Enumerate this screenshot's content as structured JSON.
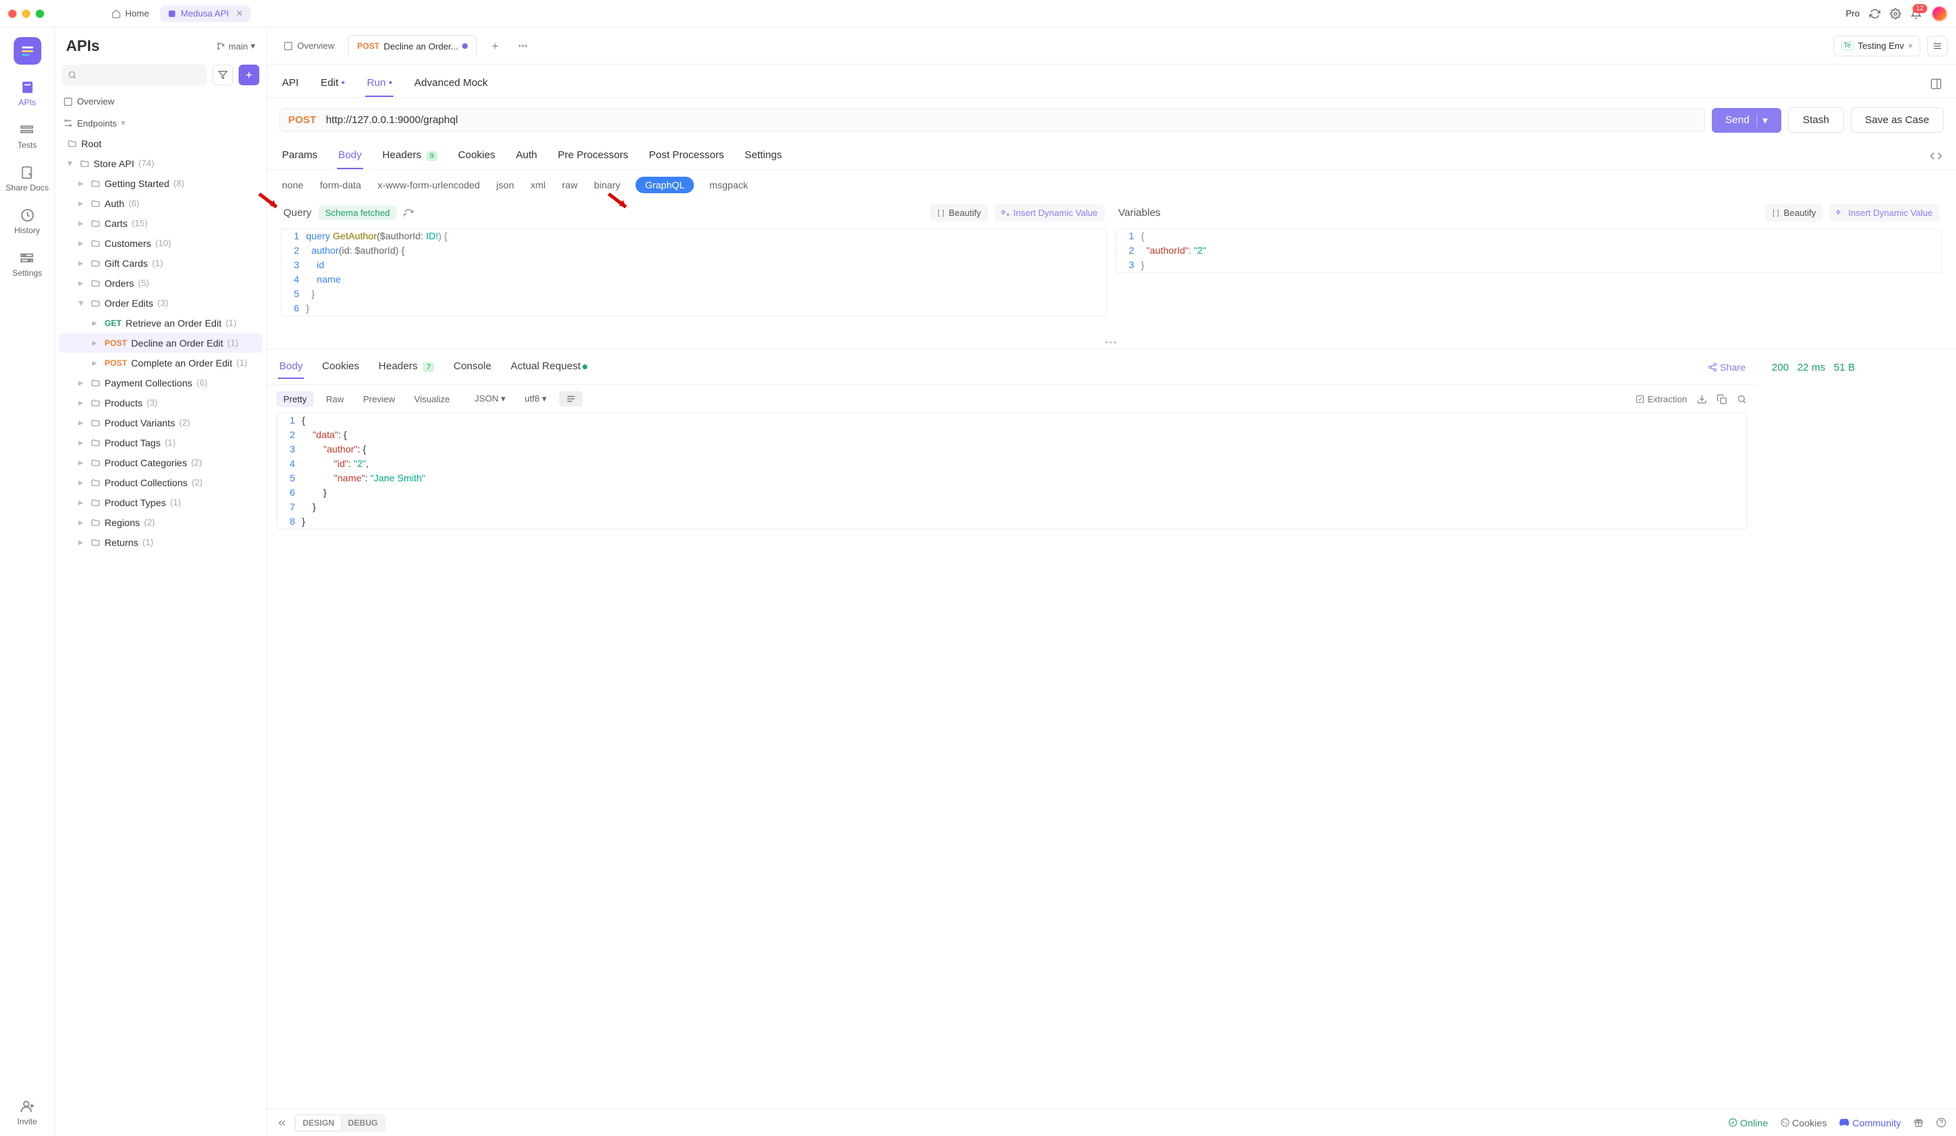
{
  "titlebar": {
    "home": "Home",
    "api_tab": "Medusa API",
    "pro": "Pro",
    "notif_count": "12"
  },
  "rail": {
    "items": [
      "APIs",
      "Tests",
      "Share Docs",
      "History",
      "Settings"
    ],
    "invite": "Invite"
  },
  "sidebar": {
    "title": "APIs",
    "branch": "main",
    "overview": "Overview",
    "endpoints": "Endpoints",
    "root": "Root",
    "store_api": "Store API",
    "store_api_cnt": "(74)",
    "items": [
      {
        "label": "Getting Started",
        "cnt": "(8)"
      },
      {
        "label": "Auth",
        "cnt": "(6)"
      },
      {
        "label": "Carts",
        "cnt": "(15)"
      },
      {
        "label": "Customers",
        "cnt": "(10)"
      },
      {
        "label": "Gift Cards",
        "cnt": "(1)"
      },
      {
        "label": "Orders",
        "cnt": "(5)"
      },
      {
        "label": "Order Edits",
        "cnt": "(3)"
      },
      {
        "label": "Payment Collections",
        "cnt": "(6)"
      },
      {
        "label": "Products",
        "cnt": "(3)"
      },
      {
        "label": "Product Variants",
        "cnt": "(2)"
      },
      {
        "label": "Product Tags",
        "cnt": "(1)"
      },
      {
        "label": "Product Categories",
        "cnt": "(2)"
      },
      {
        "label": "Product Collections",
        "cnt": "(2)"
      },
      {
        "label": "Product Types",
        "cnt": "(1)"
      },
      {
        "label": "Regions",
        "cnt": "(2)"
      },
      {
        "label": "Returns",
        "cnt": "(1)"
      }
    ],
    "order_edit_children": [
      {
        "method": "GET",
        "label": "Retrieve an Order Edit",
        "cnt": "(1)"
      },
      {
        "method": "POST",
        "label": "Decline an Order Edit",
        "cnt": "(1)"
      },
      {
        "method": "POST",
        "label": "Complete an Order Edit",
        "cnt": "(1)"
      }
    ]
  },
  "ctabs": {
    "overview": "Overview",
    "active_method": "POST",
    "active_label": "Decline an Order...",
    "env_label": "Testing Env",
    "env_tag": "Te"
  },
  "subtabs": [
    "API",
    "Edit",
    "Run",
    "Advanced Mock"
  ],
  "url": {
    "method": "POST",
    "value": "http://127.0.0.1:9000/graphql",
    "send": "Send",
    "stash": "Stash",
    "save": "Save as Case"
  },
  "reqtabs": {
    "labels": [
      "Params",
      "Body",
      "Headers",
      "Cookies",
      "Auth",
      "Pre Processors",
      "Post Processors",
      "Settings"
    ],
    "headers_badge": "9"
  },
  "bodytypes": [
    "none",
    "form-data",
    "x-www-form-urlencoded",
    "json",
    "xml",
    "raw",
    "binary",
    "GraphQL",
    "msgpack"
  ],
  "query_panel": {
    "title": "Query",
    "schema": "Schema fetched",
    "beautify": "Beautify",
    "insert": "Insert Dynamic Value"
  },
  "vars_panel": {
    "title": "Variables",
    "beautify": "Beautify",
    "insert": "Insert Dynamic Value"
  },
  "query_code": {
    "l1a": "query ",
    "l1b": "GetAuthor",
    "l1c": "($authorId: ",
    "l1d": "ID!",
    "l1e": ") {",
    "l2a": "  author",
    "l2b": "(id: $authorId) {",
    "l3": "    id",
    "l4": "    name",
    "l5": "  }",
    "l6": "}"
  },
  "vars_code": {
    "l1": "{",
    "l2a": "  \"authorId\"",
    "l2b": ": ",
    "l2c": "\"2\"",
    "l3": "}"
  },
  "resp": {
    "tabs": [
      "Body",
      "Cookies",
      "Headers",
      "Console",
      "Actual Request"
    ],
    "headers_badge": "7",
    "share": "Share",
    "status": "200",
    "time": "22 ms",
    "size": "51 B",
    "pills": [
      "Pretty",
      "Raw",
      "Preview",
      "Visualize"
    ],
    "json": "JSON",
    "utf": "utf8",
    "extraction": "Extraction"
  },
  "resp_code": {
    "l1": "{",
    "l2a": "    \"data\"",
    "l2b": ": {",
    "l3a": "        \"author\"",
    "l3b": ": {",
    "l4a": "            \"id\"",
    "l4b": ": ",
    "l4c": "\"2\"",
    "l4d": ",",
    "l5a": "            \"name\"",
    "l5b": ": ",
    "l5c": "\"Jane Smith\"",
    "l6": "        }",
    "l7": "    }",
    "l8": "}"
  },
  "footer": {
    "design": "DESIGN",
    "debug": "DEBUG",
    "online": "Online",
    "cookies": "Cookies",
    "community": "Community"
  }
}
